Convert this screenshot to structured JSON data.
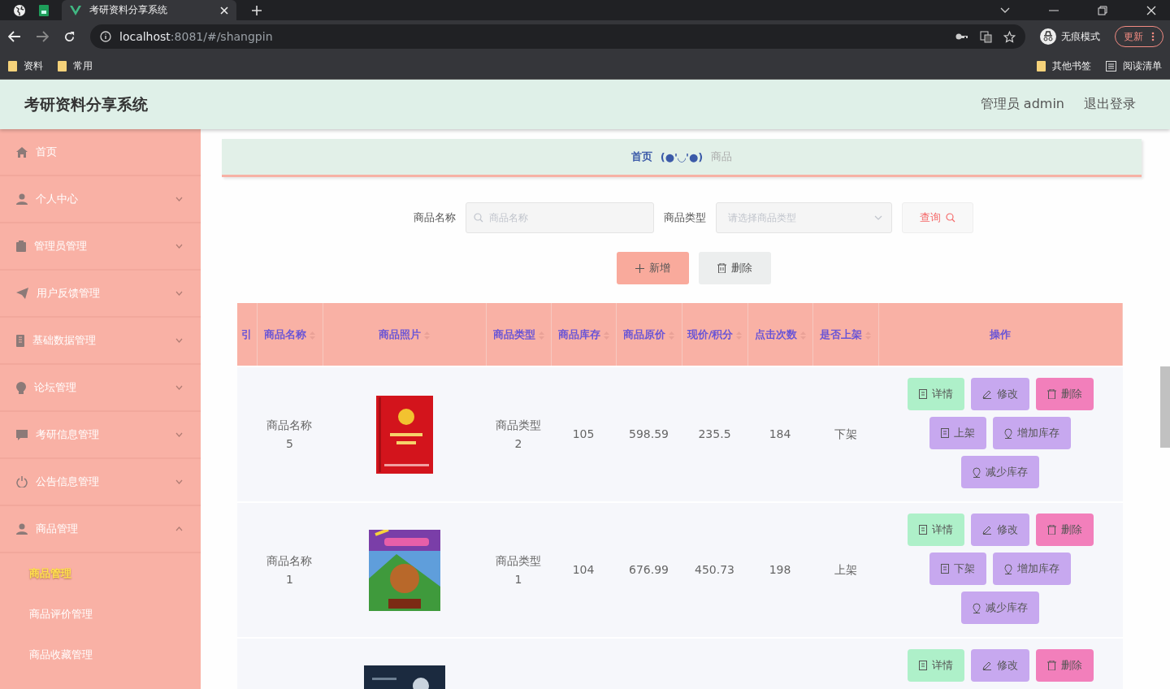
{
  "browser": {
    "tabs": [
      {
        "title": "考研资料分享系统",
        "selected": true
      }
    ],
    "url": {
      "host": "localhost",
      "rest": ":8081/#/shangpin"
    },
    "incognito": "无痕模式",
    "update": "更新",
    "bookmarks": [
      "资料",
      "常用"
    ],
    "other_bookmarks": "其他书签",
    "reading_list": "阅读清单"
  },
  "header": {
    "title": "考研资料分享系统",
    "user": "管理员 admin",
    "logout": "退出登录"
  },
  "sidebar": {
    "items": [
      {
        "label": "首页"
      },
      {
        "label": "个人中心",
        "expanded": false
      },
      {
        "label": "管理员管理",
        "expanded": false
      },
      {
        "label": "用户反馈管理",
        "expanded": false
      },
      {
        "label": "基础数据管理",
        "expanded": false
      },
      {
        "label": "论坛管理",
        "expanded": false
      },
      {
        "label": "考研信息管理",
        "expanded": false
      },
      {
        "label": "公告信息管理",
        "expanded": false
      },
      {
        "label": "商品管理",
        "expanded": true,
        "children": [
          {
            "label": "商品管理",
            "selected": true
          },
          {
            "label": "商品评价管理",
            "selected": false
          },
          {
            "label": "商品收藏管理",
            "selected": false
          }
        ]
      }
    ]
  },
  "breadcrumb": {
    "home": "首页",
    "separator": "(●'◡'●)",
    "current": "商品"
  },
  "search": {
    "fields": [
      {
        "label": "商品名称",
        "placeholder": "商品名称",
        "kind": "text"
      },
      {
        "label": "商品类型",
        "placeholder": "请选择商品类型",
        "kind": "select"
      }
    ],
    "query": "查询"
  },
  "actions": {
    "add": "新增",
    "delete": "删除"
  },
  "table": {
    "columns": [
      {
        "label": "引",
        "sortable": false
      },
      {
        "label": "商品名称",
        "sortable": true
      },
      {
        "label": "商品照片",
        "sortable": true
      },
      {
        "label": "商品类型",
        "sortable": true
      },
      {
        "label": "商品库存",
        "sortable": true
      },
      {
        "label": "商品原价",
        "sortable": true
      },
      {
        "label": "现价/积分",
        "sortable": true
      },
      {
        "label": "点击次数",
        "sortable": true
      },
      {
        "label": "是否上架",
        "sortable": true
      },
      {
        "label": "操作",
        "sortable": false
      }
    ],
    "rows": [
      {
        "cells": [
          "",
          "商品名称5",
          "",
          "商品类型2",
          "105",
          "598.59",
          "235.5",
          "184",
          "下架"
        ],
        "photo": {
          "kind": "picture"
        },
        "buttons": [
          {
            "kind": "detail",
            "label": "详情"
          },
          {
            "kind": "edit",
            "label": "修改"
          },
          {
            "kind": "delete",
            "label": "删除"
          },
          {
            "kind": "shelf",
            "label": "上架"
          },
          {
            "kind": "add",
            "label": "增加库存"
          },
          {
            "kind": "reduce",
            "label": "减少库存"
          }
        ]
      },
      {
        "cells": [
          "",
          "商品名称1",
          "",
          "商品类型1",
          "104",
          "676.99",
          "450.73",
          "198",
          "上架"
        ],
        "photo": {
          "kind": "picture"
        },
        "buttons": [
          {
            "kind": "detail",
            "label": "详情"
          },
          {
            "kind": "edit",
            "label": "修改"
          },
          {
            "kind": "delete",
            "label": "删除"
          },
          {
            "kind": "shelf",
            "label": "下架"
          },
          {
            "kind": "add",
            "label": "增加库存"
          },
          {
            "kind": "reduce",
            "label": "减少库存"
          }
        ]
      },
      {
        "cells": [],
        "photo": {
          "kind": "picture"
        },
        "buttons": [
          {
            "kind": "detail",
            "label": "详情"
          },
          {
            "kind": "edit",
            "label": "修改"
          },
          {
            "kind": "delete",
            "label": "删除"
          }
        ]
      }
    ]
  }
}
